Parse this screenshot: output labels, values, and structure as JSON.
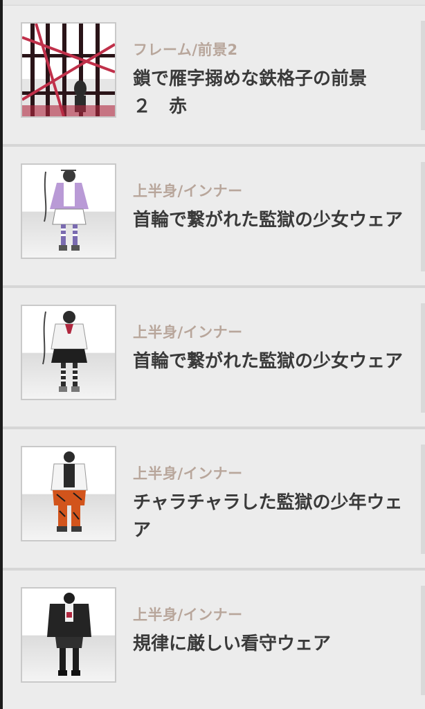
{
  "items": [
    {
      "category": "フレーム/前景2",
      "title": "鎖で雁字搦めな鉄格子の前景\n２　赤",
      "thumbnail_icon": "prison-bars-foreground-icon"
    },
    {
      "category": "上半身/インナー",
      "title": "首輪で繋がれた監獄の少女ウェア",
      "thumbnail_icon": "prison-girl-outfit-purple-icon"
    },
    {
      "category": "上半身/インナー",
      "title": "首輪で繋がれた監獄の少女ウェア",
      "thumbnail_icon": "prison-girl-outfit-red-icon"
    },
    {
      "category": "上半身/インナー",
      "title": "チャラチャラした監獄の少年ウェア",
      "thumbnail_icon": "prison-boy-outfit-icon"
    },
    {
      "category": "上半身/インナー",
      "title": "規律に厳しい看守ウェア",
      "thumbnail_icon": "prison-guard-outfit-icon"
    }
  ]
}
